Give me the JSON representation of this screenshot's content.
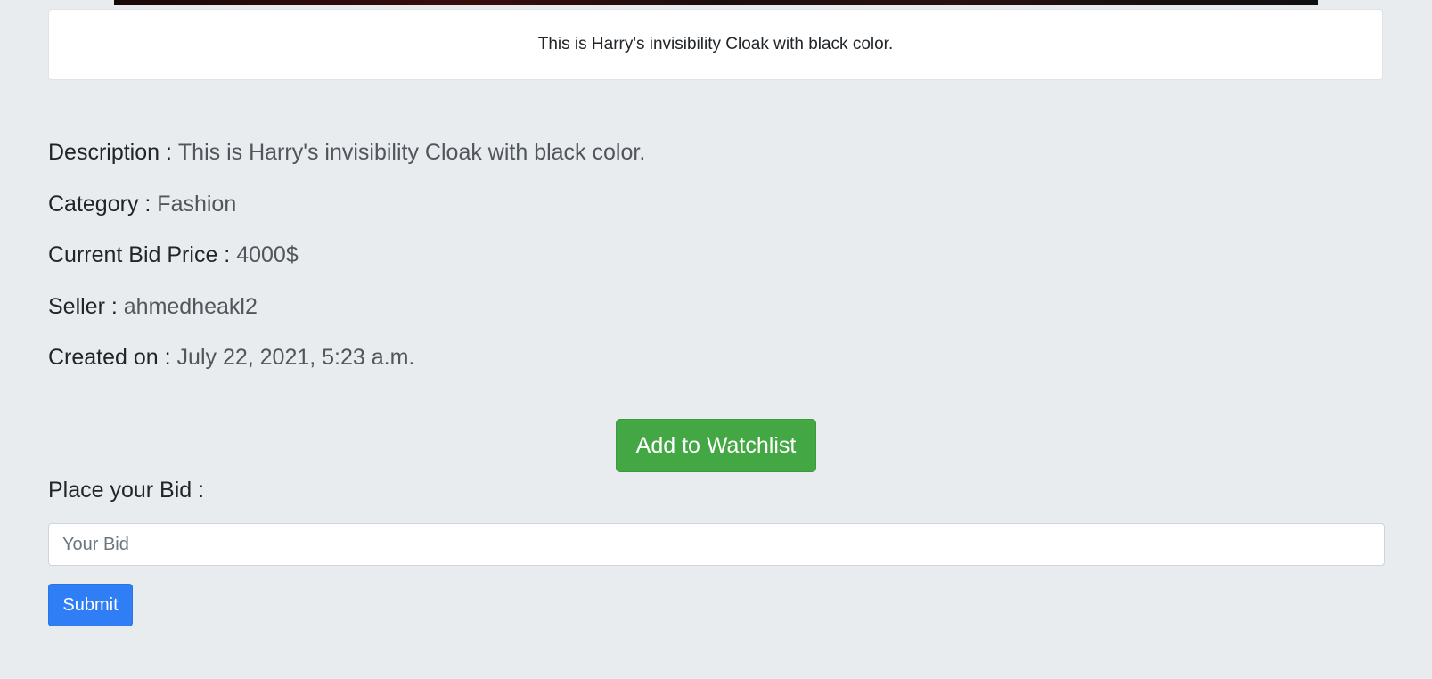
{
  "caption": "This is Harry's invisibility Cloak with black color.",
  "details": [
    {
      "label": "Description :",
      "value": "This is Harry's invisibility Cloak with black color."
    },
    {
      "label": "Category :",
      "value": "Fashion"
    },
    {
      "label": "Current Bid Price :",
      "value": "4000$"
    },
    {
      "label": "Seller :",
      "value": "ahmedheakl2"
    },
    {
      "label": "Created on :",
      "value": "July 22, 2021, 5:23 a.m."
    }
  ],
  "watchlist_button": "Add to Watchlist",
  "bid": {
    "label": "Place your Bid :",
    "placeholder": "Your Bid",
    "value": "",
    "submit_label": "Submit"
  },
  "colors": {
    "background": "#e8ecef",
    "watchlist_button": "#43a843",
    "submit_button": "#2f7ef6"
  }
}
